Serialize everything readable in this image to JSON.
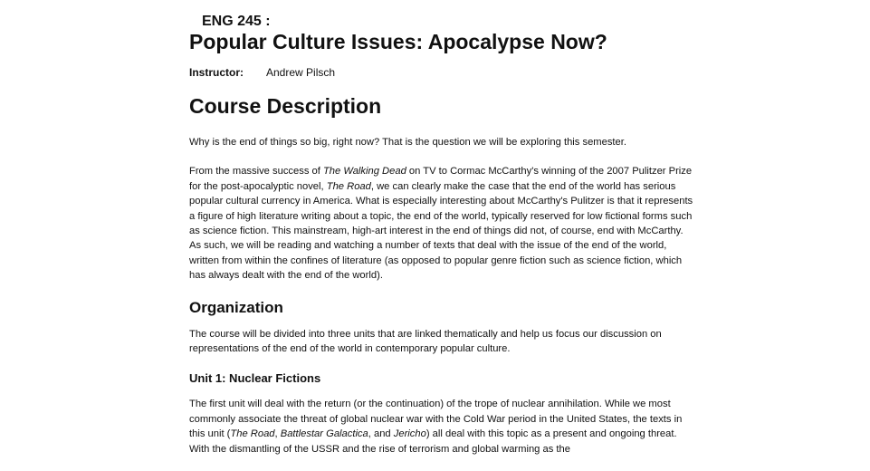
{
  "header": {
    "course_code": "ENG 245 :",
    "course_title": "Popular Culture Issues: Apocalypse Now?",
    "instructor_label": "Instructor:",
    "instructor_name": "Andrew Pilsch"
  },
  "course_description": {
    "heading": "Course Description",
    "intro": "Why is the end of things so big, right now? That is the question we will be exploring this semester.",
    "para2": {
      "t1": "From the massive success of ",
      "walking_dead": "The Walking Dead",
      "t2": " on TV to Cormac McCarthy's winning of the 2007 Pulitzer Prize for the post-apocalyptic novel, ",
      "the_road": "The Road",
      "t3": ", we can clearly make the case that the end of the world has serious popular cultural currency in America. What is especially interesting about McCarthy's Pulitzer is that it represents a figure of high literature writing about a topic, the end of the world, typically reserved for low fictional forms such as science fiction. This mainstream, high-art interest in the end of things did not, of course, end with McCarthy. As such, we will be reading and watching a number of texts that deal with the issue of the end of the world, written from within the confines of literature (as opposed to popular genre fiction such as science fiction, which has always dealt with the end of the world)."
    }
  },
  "organization": {
    "heading": "Organization",
    "intro": "The course will be divided into three units that are linked thematically and help us focus our discussion on representations of the end of the world in contemporary popular culture."
  },
  "unit1": {
    "heading": "Unit 1: Nuclear Fictions",
    "para": {
      "t1": "The first unit will deal with the return (or the continuation) of the trope of nuclear annihilation. While we most commonly associate the threat of global nuclear war with the Cold War period in the United States, the texts in this unit (",
      "the_road": "The Road",
      "t2": ", ",
      "battlestar": "Battlestar Galactica",
      "t3": ", and ",
      "jericho": "Jericho",
      "t4": ") all deal with this topic as a present and ongoing threat. With the dismantling of the USSR and the rise of terrorism and global warming as the"
    }
  }
}
